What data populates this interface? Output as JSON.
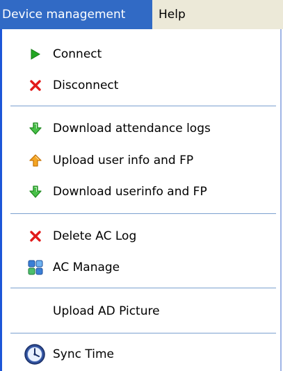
{
  "menubar": {
    "items": [
      {
        "label": "Device management"
      },
      {
        "label": "Help"
      }
    ]
  },
  "menu": {
    "items": [
      {
        "label": "Connect",
        "icon": "play-icon",
        "color": "#22a522"
      },
      {
        "label": "Disconnect",
        "icon": "close-x-icon",
        "color": "#e21a1a"
      },
      {
        "label": "Download attendance logs",
        "icon": "green-down-arrow-icon",
        "color": "#37b537"
      },
      {
        "label": "Upload user info and FP",
        "icon": "orange-up-arrow-icon",
        "color": "#f2a322"
      },
      {
        "label": "Download userinfo and FP",
        "icon": "green-down-arrow-icon",
        "color": "#37b537"
      },
      {
        "label": "Delete AC Log",
        "icon": "close-x-icon",
        "color": "#e21a1a"
      },
      {
        "label": "AC Manage",
        "icon": "grid-blocks-icon",
        "color": "#3a7fd6"
      },
      {
        "label": "Upload AD Picture",
        "icon": "",
        "color": ""
      },
      {
        "label": "Sync Time",
        "icon": "clock-icon",
        "color": "#2f4f9a"
      }
    ]
  },
  "colors": {
    "menubar_active_bg": "#316ac5",
    "menu_border": "#1c56d8",
    "separator": "#7aa0cf"
  }
}
